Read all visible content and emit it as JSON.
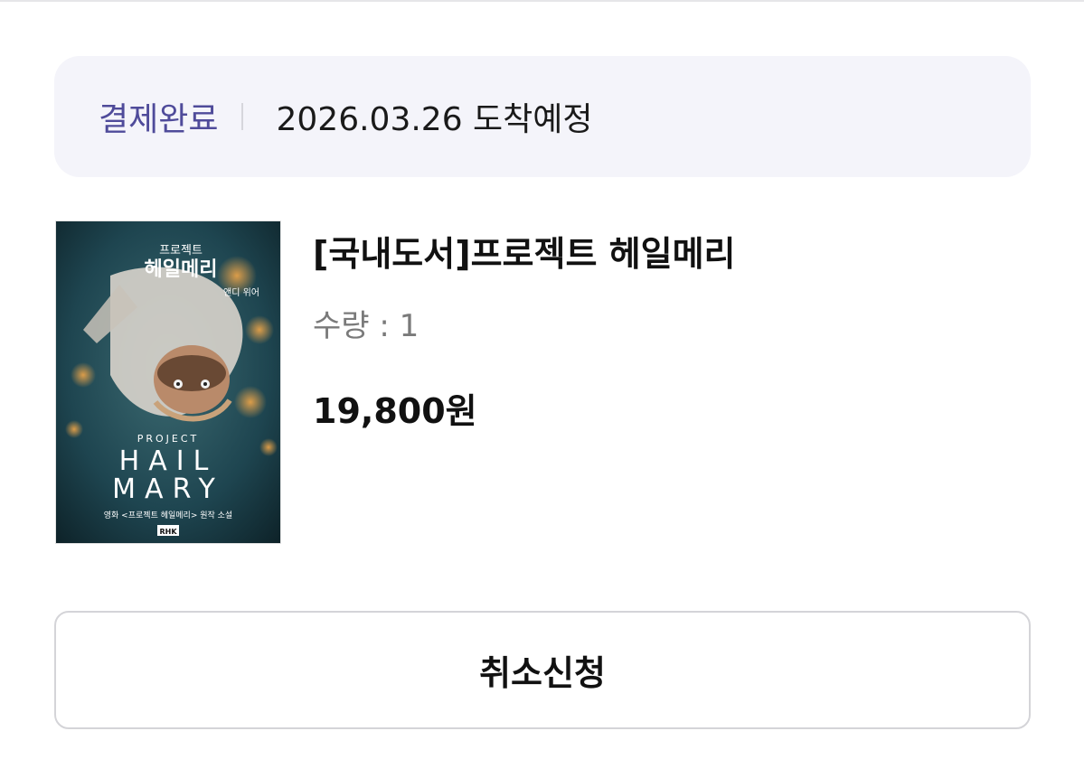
{
  "order_status": {
    "status_label": "결제완료",
    "delivery_text": "2026.03.26 도착예정"
  },
  "product": {
    "title": "[국내도서]프로젝트 헤일메리",
    "quantity_text": "수량 : 1",
    "price_text": "19,800원",
    "cover": {
      "title_ko_small": "프로젝트",
      "title_ko": "헤일메리",
      "author": "앤디 위어",
      "project_label": "PROJECT",
      "title_en_line1": "HAIL",
      "title_en_line2": "MARY",
      "tagline": "영화 <프로젝트 헤일메리> 원작 소설",
      "publisher": "RHK"
    }
  },
  "actions": {
    "cancel_label": "취소신청"
  },
  "colors": {
    "status_accent": "#4f4b9a",
    "banner_bg": "#f4f4fa",
    "button_border": "#d4d4d8"
  }
}
